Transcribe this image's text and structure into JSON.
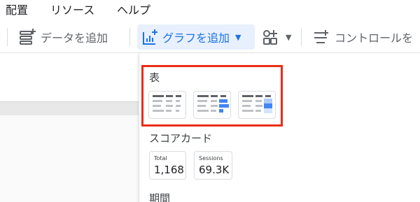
{
  "menubar": {
    "items": [
      {
        "label": "配置"
      },
      {
        "label": "リソース"
      },
      {
        "label": "ヘルプ"
      }
    ]
  },
  "toolbar": {
    "add_data_label": "データを追加",
    "add_chart_label": "グラフを追加",
    "add_control_label": "コントロールを"
  },
  "icons": {
    "add_data": "add-data-icon",
    "add_chart": "add-chart-icon",
    "components": "community-visualizations-icon",
    "control": "filter-control-icon"
  },
  "colors": {
    "accent": "#1a73e8",
    "accent_bg": "#e8f0fe",
    "highlight": "#ea2d16"
  },
  "dropdown": {
    "table_section": {
      "title": "表",
      "variants": [
        "table",
        "table-with-bars",
        "table-heatmap"
      ]
    },
    "scorecard_section": {
      "title": "スコアカード",
      "cards": [
        {
          "label": "Total",
          "value": "1,168"
        },
        {
          "label": "Sessions",
          "value": "69.3K"
        }
      ]
    },
    "period_section": {
      "title": "期間"
    }
  }
}
